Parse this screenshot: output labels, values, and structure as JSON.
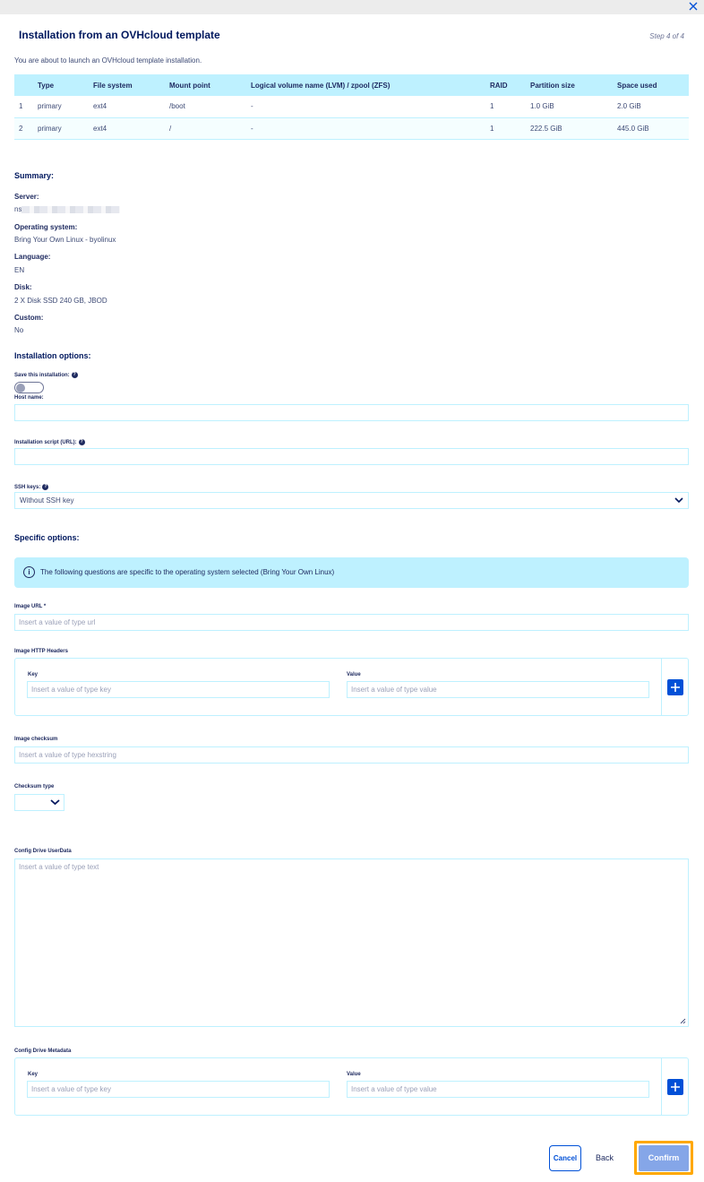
{
  "dialog": {
    "title": "Installation from an OVHcloud template",
    "step": "Step 4 of 4",
    "intro": "You are about to launch an OVHcloud template installation."
  },
  "partitions": {
    "headers": [
      "",
      "Type",
      "File system",
      "Mount point",
      "Logical volume name (LVM) / zpool (ZFS)",
      "RAID",
      "Partition size",
      "Space used"
    ],
    "rows": [
      [
        "1",
        "primary",
        "ext4",
        "/boot",
        "-",
        "1",
        "1.0 GiB",
        "2.0 GiB"
      ],
      [
        "2",
        "primary",
        "ext4",
        "/",
        "-",
        "1",
        "222.5 GiB",
        "445.0 GiB"
      ]
    ]
  },
  "summary": {
    "heading": "Summary:",
    "server_label": "Server:",
    "server_value": "ns",
    "os_label": "Operating system:",
    "os_value": "Bring Your Own Linux - byolinux",
    "language_label": "Language:",
    "language_value": "EN",
    "disk_label": "Disk:",
    "disk_value": "2 X Disk SSD 240 GB, JBOD",
    "custom_label": "Custom:",
    "custom_value": "No"
  },
  "install_options": {
    "heading": "Installation options:",
    "save_label": "Save this installation:",
    "save_enabled": false,
    "hostname_label": "Host name:",
    "hostname_value": "",
    "script_label": "Installation script (URL):",
    "script_value": "",
    "ssh_label": "SSH keys:",
    "ssh_value": "Without SSH key"
  },
  "specific_options": {
    "heading": "Specific options:",
    "info": "The following questions are specific to the operating system selected (Bring Your Own Linux)",
    "image_url_label": "Image URL *",
    "image_url_placeholder": "Insert a value of type url",
    "headers_label": "Image HTTP Headers",
    "key_label": "Key",
    "value_label": "Value",
    "key_placeholder": "Insert a value of type key",
    "value_placeholder": "Insert a value of type value",
    "checksum_label": "Image checksum",
    "checksum_placeholder": "Insert a value of type hexstring",
    "checksum_type_label": "Checksum type",
    "userdata_label": "Config Drive UserData",
    "userdata_placeholder": "Insert a value of type text",
    "metadata_label": "Config Drive Metadata"
  },
  "actions": {
    "cancel": "Cancel",
    "back": "Back",
    "confirm": "Confirm"
  },
  "colors": {
    "accent": "#0050d7",
    "table_header": "#bef1ff",
    "highlight": "#ffa800",
    "title": "#00185e"
  }
}
